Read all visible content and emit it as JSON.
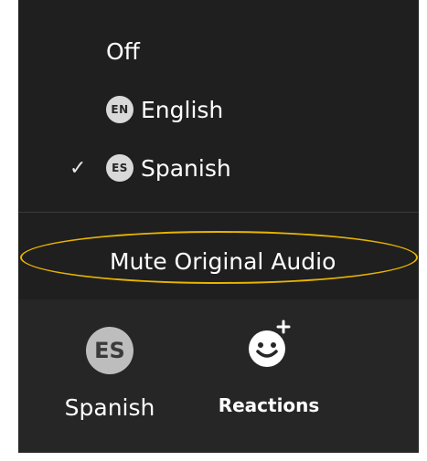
{
  "language_menu": {
    "items": [
      {
        "label": "Off",
        "badge": ""
      },
      {
        "label": "English",
        "badge": "EN"
      },
      {
        "label": "Spanish",
        "badge": "ES",
        "selected": true
      }
    ],
    "check_glyph": "✓",
    "mute_label": "Mute Original Audio",
    "highlight_color": "#e8b400"
  },
  "toolbar": {
    "spanish_avatar": "ES",
    "spanish_label": "Spanish",
    "reactions_label": "Reactions",
    "reactions_icon": "smiley-add-icon"
  }
}
